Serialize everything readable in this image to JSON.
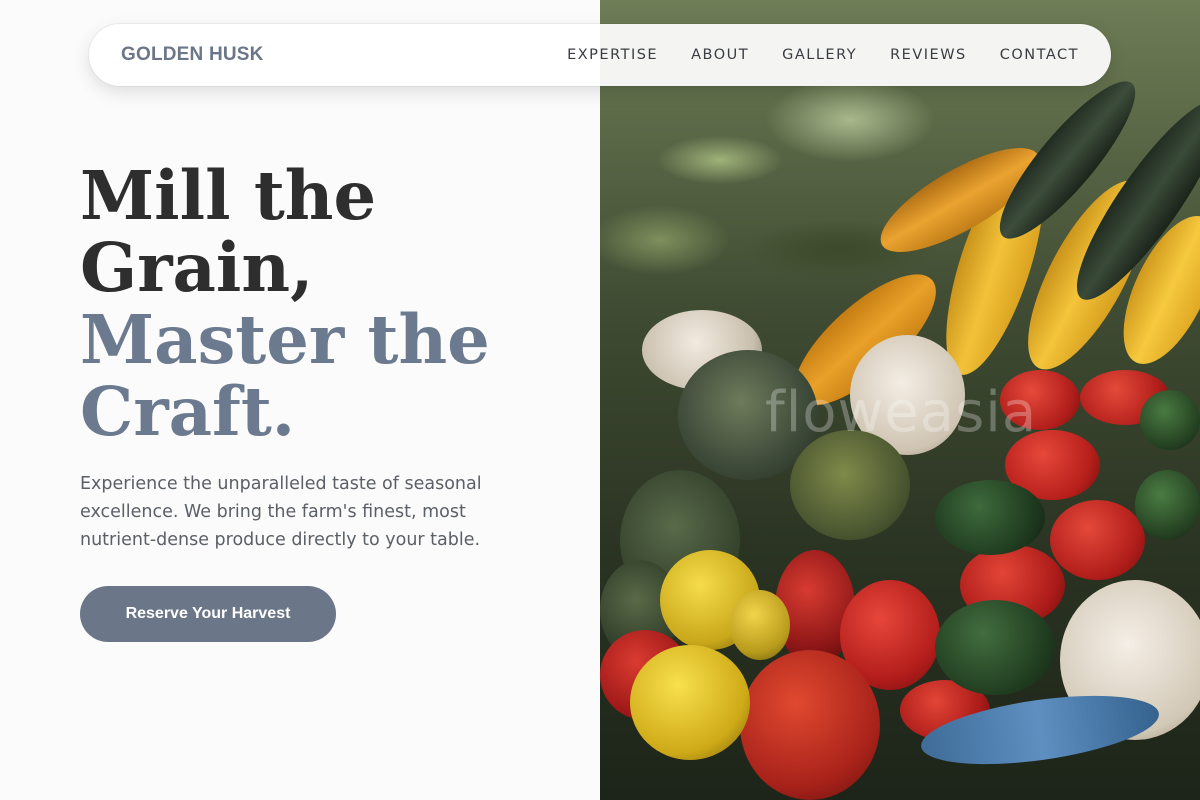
{
  "brand": {
    "name": "GOLDEN HUSK"
  },
  "nav": {
    "items": [
      "EXPERTISE",
      "ABOUT",
      "GALLERY",
      "REVIEWS",
      "CONTACT"
    ]
  },
  "hero": {
    "title_line1": "Mill the",
    "title_line2": "Grain,",
    "title_line3": "Master the",
    "title_line4": "Craft.",
    "description": "Experience the unparalleled taste of seasonal excellence. We bring the farm's finest, most nutrient-dense produce directly to your table.",
    "cta_label": "Reserve Your Harvest"
  },
  "photo": {
    "watermark": "floweasia"
  },
  "colors": {
    "accent": "#6b7789",
    "title_dark": "#2e2e2e",
    "title_accent": "#6b7a8e",
    "page_bg": "#fbfbfb"
  }
}
